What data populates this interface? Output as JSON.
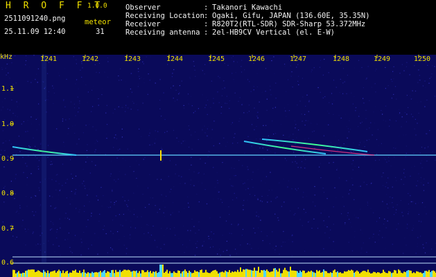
{
  "header": {
    "app_title": "H R O F F T",
    "app_version": "1.0.0",
    "filename": "2511091240.png",
    "meteor_label": "meteor",
    "datetime": "25.11.09 12:40",
    "meteor_count": "31"
  },
  "info": {
    "observer_key": "Observer",
    "observer_value": "Takanori Kawachi",
    "location_key": "Receiving Location",
    "location_value": "Ogaki, Gifu, JAPAN (136.60E, 35.35N)",
    "receiver_key": "Receiver",
    "receiver_value": "R820T2(RTL-SDR) SDR-Sharp 53.372MHz",
    "antenna_key": "Receiving antenna",
    "antenna_value": "2el-HB9CV Vertical (el. E-W)",
    "separator": ":"
  },
  "axes": {
    "y_unit": "kHz",
    "x_ticks": [
      "1241",
      "1242",
      "1243",
      "1244",
      "1245",
      "1246",
      "1247",
      "1248",
      "1249",
      "1250"
    ],
    "y_ticks": [
      "1.1",
      "1.0",
      "0.9",
      "0.8",
      "0.7",
      "0.6"
    ]
  },
  "colors": {
    "label_yellow": "#f0e000",
    "text_white": "#f4f4f4",
    "background_blue": "#0a0a5a"
  }
}
